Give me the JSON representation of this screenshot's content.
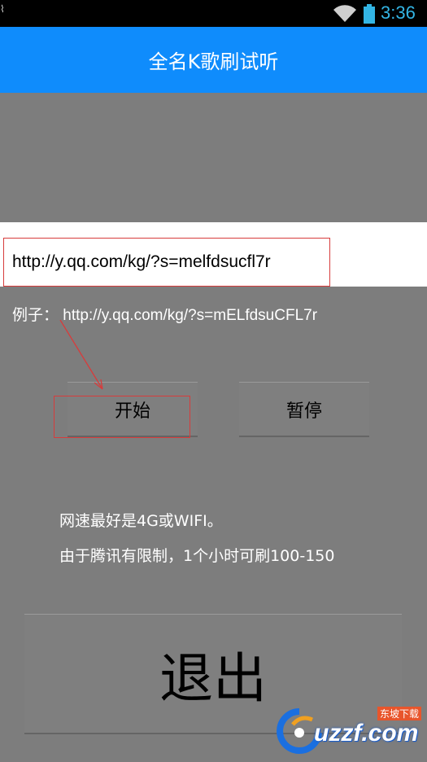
{
  "status_bar": {
    "time": "3:36",
    "notification_icon": "notification-icon",
    "wifi_icon": "wifi-icon",
    "battery_icon": "battery-icon"
  },
  "app_bar": {
    "title": "全名K歌刷试听"
  },
  "url_input": {
    "value": "http://y.qq.com/kg/?s=melfdsucfl7r"
  },
  "example": {
    "text": "例子： http://y.qq.com/kg/?s=mELfdsuCFL7r"
  },
  "buttons": {
    "start": "开始",
    "pause": "暂停",
    "exit": "退出"
  },
  "notes": [
    "网速最好是4G或WIFI。",
    "由于腾讯有限制，1个小时可刷100-150"
  ],
  "watermark": {
    "logo": "uzzf.com",
    "tagline": "东坡下载"
  },
  "colors": {
    "app_bar": "#0f8cfc",
    "background": "#7d7d7d",
    "annotation": "#d73c3c",
    "clock": "#33b5e5"
  }
}
